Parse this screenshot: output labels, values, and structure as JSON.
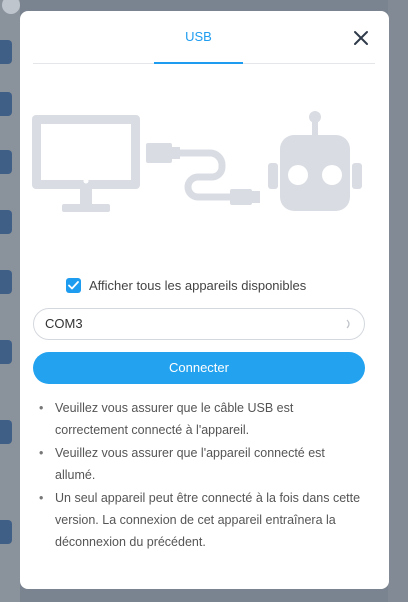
{
  "modal": {
    "tab_usb": "USB",
    "close_icon": "close-icon",
    "show_all_label": "Afficher tous les appareils disponibles",
    "show_all_checked": true,
    "port_select": {
      "value": "COM3"
    },
    "connect_label": "Connecter",
    "notes": [
      "Veuillez vous assurer que le câble USB est correctement connecté à l'appareil.",
      "Veuillez vous assurer que l'appareil connecté est allumé.",
      "Un seul appareil peut être connecté à la fois dans cette version. La connexion de cet appareil entraînera la déconnexion du précédent."
    ]
  },
  "colors": {
    "accent": "#1e9cf0",
    "illustration": "#d9dde3",
    "overlay": "#7a8390"
  }
}
